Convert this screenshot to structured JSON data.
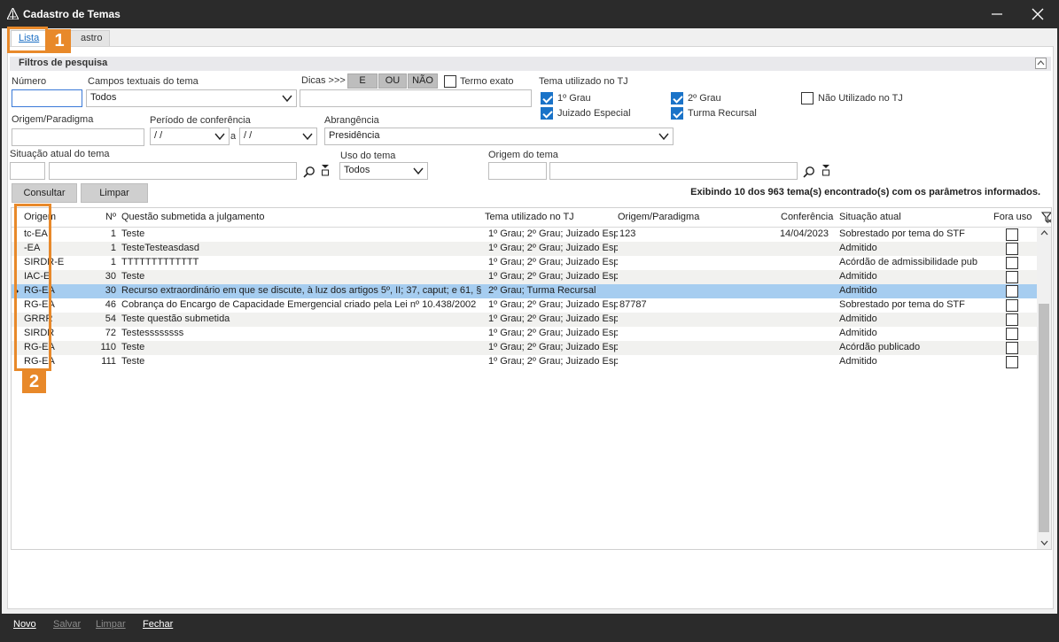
{
  "window": {
    "title": "Cadastro de Temas"
  },
  "tabs": {
    "lista": "Lista",
    "cadastro": "astro"
  },
  "callouts": {
    "one": "1",
    "two": "2"
  },
  "filters": {
    "section_title": "Filtros de pesquisa",
    "numero_label": "Número",
    "numero_value": "",
    "campos_label": "Campos textuais do tema",
    "campos_value": "Todos",
    "dicas_label": "Dicas >>>",
    "dicas_e": "E",
    "dicas_ou": "OU",
    "dicas_nao": "NÃO",
    "termo_exato": "Termo exato",
    "termo_value": "",
    "tema_tj_label": "Tema utilizado no TJ",
    "tj_options": {
      "grau1": "1º Grau",
      "grau2": "2º Grau",
      "nao_utilizado": "Não Utilizado no TJ",
      "juizado": "Juizado Especial",
      "turma": "Turma Recursal"
    },
    "origem_paradigma_label": "Origem/Paradigma",
    "origem_paradigma_value": "",
    "periodo_label": "Período de conferência",
    "periodo_de": "/ /",
    "periodo_a_label": "a",
    "periodo_ate": "/ /",
    "abrangencia_label": "Abrangência",
    "abrangencia_value": "Presidência",
    "situacao_label": "Situação atual do tema",
    "situacao_code": "",
    "situacao_desc": "",
    "uso_label": "Uso do tema",
    "uso_value": "Todos",
    "origem_tema_label": "Origem do tema",
    "origem_tema_code": "",
    "origem_tema_desc": ""
  },
  "actions": {
    "consultar": "Consultar",
    "limpar": "Limpar",
    "summary": "Exibindo 10 dos 963 tema(s) encontrado(s) com os parâmetros informados."
  },
  "grid": {
    "headers": {
      "origem": "Origem",
      "numero": "Nº",
      "questao": "Questão submetida a julgamento",
      "tema_tj": "Tema utilizado no TJ",
      "origem_paradigma": "Origem/Paradigma",
      "conferencia": "Conferência",
      "situacao": "Situação atual",
      "fora_uso": "Fora uso"
    },
    "rows": [
      {
        "origem": "tc-EA",
        "numero": "1",
        "questao": "Teste",
        "tema_tj": "1º Grau; 2º Grau; Juizado Esp",
        "origem_paradigma": "123",
        "conferencia": "14/04/2023",
        "situacao": "Sobrestado por tema do STF"
      },
      {
        "origem": "-EA",
        "numero": "1",
        "questao": "TesteTesteasdasd",
        "tema_tj": "1º Grau; 2º Grau; Juizado Esp",
        "origem_paradigma": "",
        "conferencia": "",
        "situacao": "Admitido"
      },
      {
        "origem": "SIRDR-E",
        "numero": "1",
        "questao": "TTTTTTTTTTTTT",
        "tema_tj": "1º Grau; 2º Grau; Juizado Esp",
        "origem_paradigma": "",
        "conferencia": "",
        "situacao": "Acórdão de admissibilidade pub"
      },
      {
        "origem": "IAC-E",
        "numero": "30",
        "questao": "Teste",
        "tema_tj": "1º Grau; 2º Grau; Juizado Esp",
        "origem_paradigma": "",
        "conferencia": "",
        "situacao": "Admitido"
      },
      {
        "origem": "RG-EA",
        "numero": "30",
        "questao": "Recurso extraordinário em que se discute, à luz dos artigos 5º, II; 37, caput; e 61, §",
        "tema_tj": "2º Grau; Turma Recursal",
        "origem_paradigma": "",
        "conferencia": "",
        "situacao": "Admitido"
      },
      {
        "origem": "RG-EA",
        "numero": "46",
        "questao": "Cobrança do Encargo de Capacidade Emergencial criado pela Lei nº 10.438/2002",
        "tema_tj": "1º Grau; 2º Grau; Juizado Esp",
        "origem_paradigma": "87787",
        "conferencia": "",
        "situacao": "Sobrestado por tema do STF"
      },
      {
        "origem": "GRRR",
        "numero": "54",
        "questao": "Teste questão submetida",
        "tema_tj": "1º Grau; 2º Grau; Juizado Esp",
        "origem_paradigma": "",
        "conferencia": "",
        "situacao": "Admitido"
      },
      {
        "origem": "SIRDR",
        "numero": "72",
        "questao": "Testessssssss",
        "tema_tj": "1º Grau; 2º Grau; Juizado Esp",
        "origem_paradigma": "",
        "conferencia": "",
        "situacao": "Admitido"
      },
      {
        "origem": "RG-EA",
        "numero": "110",
        "questao": "Teste",
        "tema_tj": "1º Grau; 2º Grau; Juizado Esp",
        "origem_paradigma": "",
        "conferencia": "",
        "situacao": "Acórdão publicado"
      },
      {
        "origem": "RG-EA",
        "numero": "111",
        "questao": "Teste",
        "tema_tj": "1º Grau; 2º Grau; Juizado Esp",
        "origem_paradigma": "",
        "conferencia": "",
        "situacao": "Admitido"
      }
    ]
  },
  "footer": {
    "novo": "Novo",
    "salvar": "Salvar",
    "limpar": "Limpar",
    "fechar": "Fechar"
  }
}
